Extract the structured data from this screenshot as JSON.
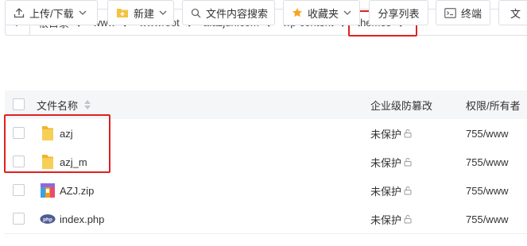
{
  "breadcrumb": {
    "items": [
      "根目录",
      "www",
      "wwwroot",
      "a.azjun.com",
      "wp-content",
      "themes"
    ]
  },
  "toolbar": {
    "upload_download": "上传/下载",
    "new": "新建",
    "content_search": "文件内容搜索",
    "favorites": "收藏夹",
    "share_list": "分享列表",
    "terminal": "终端",
    "more": "文"
  },
  "table": {
    "headers": {
      "name": "文件名称",
      "protection": "企业级防篡改",
      "permission": "权限/所有者"
    },
    "rows": [
      {
        "name": "azj",
        "type": "folder",
        "protection": "未保护",
        "permission": "755/www"
      },
      {
        "name": "azj_m",
        "type": "folder",
        "protection": "未保护",
        "permission": "755/www"
      },
      {
        "name": "AZJ.zip",
        "type": "zip",
        "protection": "未保护",
        "permission": "755/www"
      },
      {
        "name": "index.php",
        "type": "php",
        "protection": "未保护",
        "permission": "755/www"
      }
    ]
  },
  "icons": {
    "php_label": "php"
  },
  "colors": {
    "highlight": "#e02020",
    "folder": "#f5c242",
    "border": "#dcdfe6"
  }
}
